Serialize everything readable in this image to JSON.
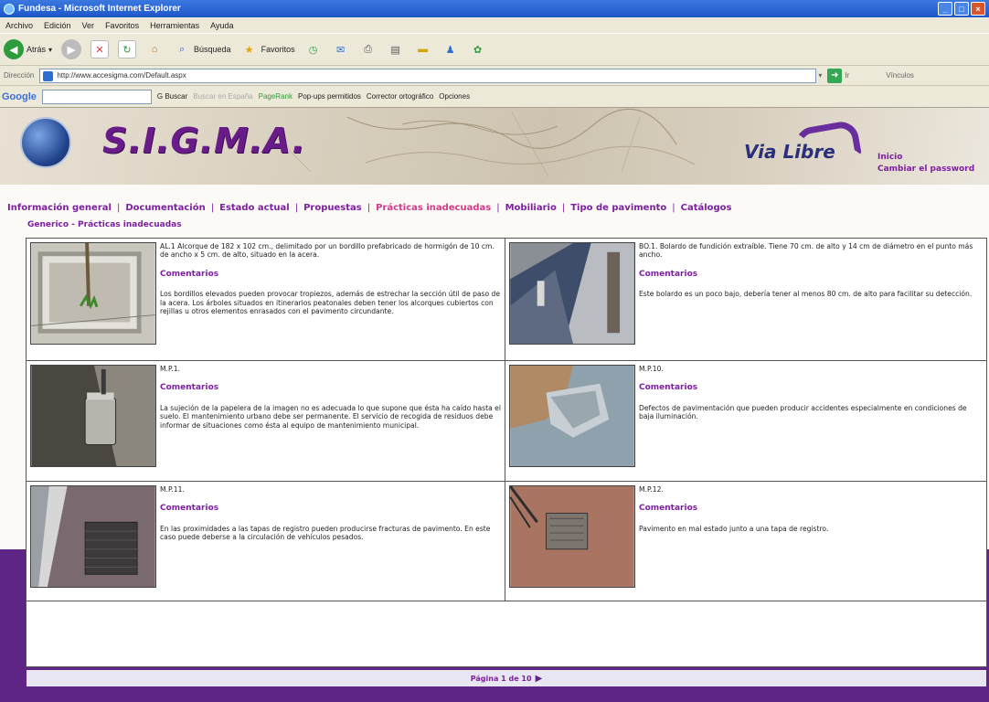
{
  "window": {
    "title": "Fundesa - Microsoft Internet Explorer"
  },
  "menu": [
    "Archivo",
    "Edición",
    "Ver",
    "Favoritos",
    "Herramientas",
    "Ayuda"
  ],
  "toolbar": {
    "back": "Atrás",
    "search": "Búsqueda",
    "favorites": "Favoritos"
  },
  "address": {
    "label": "Dirección",
    "url": "http://www.accesigma.com/Default.aspx",
    "go": "Ir",
    "links": "Vínculos"
  },
  "googlebar": {
    "logo": "Google",
    "search_btn": "Buscar",
    "site_search": "Buscar en España",
    "pagerank": "PageRank",
    "popups": "Pop-ups permitidos",
    "spell": "Corrector ortográfico",
    "options": "Opciones"
  },
  "banner": {
    "logo": "S.I.G.M.A.",
    "partner": "Via Libre",
    "link_home": "Inicio",
    "link_password": "Cambiar el password"
  },
  "nav": {
    "items": [
      "Información general",
      "Documentación",
      "Estado actual",
      "Propuestas",
      "Prácticas inadecuadas",
      "Mobiliario",
      "Tipo de pavimento",
      "Catálogos"
    ],
    "active_index": 4
  },
  "breadcrumb": "Generico - Prácticas inadecuadas",
  "items": [
    {
      "code": "AL.1 Alcorque de 182 x 102 cm., delimitado por un bordillo prefabricado de hormigón de 10 cm. de ancho x 5 cm. de alto, situado en la acera.",
      "title": "Comentarios",
      "comment": "Los bordillos elevados pueden provocar tropiezos, además de estrechar la sección útil de paso de la acera. Los árboles situados en itinerarios peatonales deben tener los alcorques cubiertos con rejillas u otros elementos enrasados con el pavimento circundante.",
      "photo": "tree-pit-photo"
    },
    {
      "code": "BO.1. Bolardo de fundición extraíble. Tiene 70 cm. de alto y 14 cm de diámetro en el punto más ancho.",
      "title": "Comentarios",
      "comment": "Este bolardo es un poco bajo, debería tener al menos 80 cm. de alto para facilitar su detección.",
      "photo": "bollard-photo"
    },
    {
      "code": "M.P.1.",
      "title": "Comentarios",
      "comment": "La sujeción de la papelera de la imagen no es adecuada lo que supone que ésta ha caído hasta el suelo. El mantenimiento urbano debe ser permanente. El servicio de recogida de residuos debe informar de situaciones como ésta al equipo de mantenimiento municipal.",
      "photo": "litter-bin-photo"
    },
    {
      "code": "M.P.10.",
      "title": "Comentarios",
      "comment": "Defectos de pavimentación que pueden producir accidentes especialmente en condiciones de baja iluminación.",
      "photo": "pavement-defect-photo"
    },
    {
      "code": "M.P.11.",
      "title": "Comentarios",
      "comment": "En las proximidades a las tapas de registro pueden producirse fracturas de pavimento. En este caso puede deberse a la circulación de vehículos pesados.",
      "photo": "manhole-cracks-photo"
    },
    {
      "code": "M.P.12.",
      "title": "Comentarios",
      "comment": "Pavimento en mal estado junto a una tapa de registro.",
      "photo": "manhole-pavement-photo"
    }
  ],
  "pagination": {
    "text": "Página 1 de 10"
  },
  "colors": {
    "brand": "#7d1fa0",
    "active_nav": "#d43a8a",
    "band": "#5e2486"
  }
}
